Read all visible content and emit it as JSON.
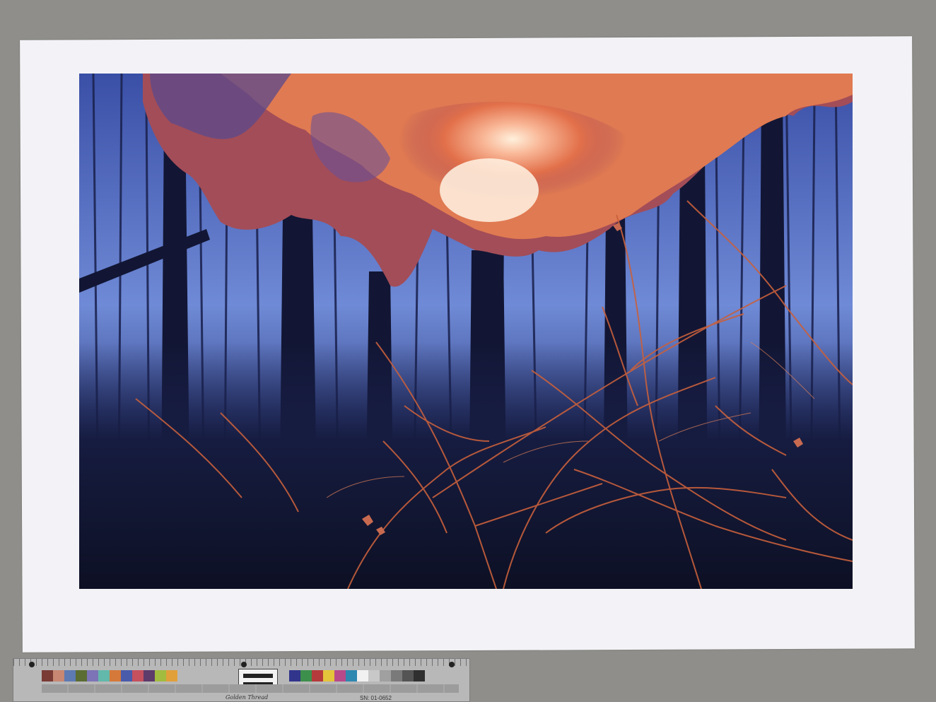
{
  "scene": {
    "subject": "bare forest at dusk with orange-pink smoke cloud",
    "colors": {
      "sky": "#5a78c8",
      "forest_dark": "#141a3a",
      "smoke_bright": "#f6c0a0",
      "smoke_mid": "#e8784c",
      "branches": "#c8603c",
      "mat": "#f3f3f7",
      "background": "#8f8e8a"
    }
  },
  "color_target": {
    "patches": [
      "#7a3b35",
      "#c78772",
      "#5d7ab3",
      "#5b6d33",
      "#7c74b6",
      "#62b8aa",
      "#d5793a",
      "#4a5bab",
      "#c5505e",
      "#5d3b6a",
      "#a2bc3f",
      "#e2a03a"
    ],
    "patches_right": [
      "#31358b",
      "#3d8f4c",
      "#b53a3b",
      "#e4c43a",
      "#b84a8a",
      "#2e88b0",
      "#f1f1f1",
      "#c8c8c8",
      "#a0a0a0",
      "#7a7a7a",
      "#545454",
      "#2f2f2f"
    ],
    "brand_text": "Golden Thread",
    "serial_text": "SN: 01-0652"
  }
}
